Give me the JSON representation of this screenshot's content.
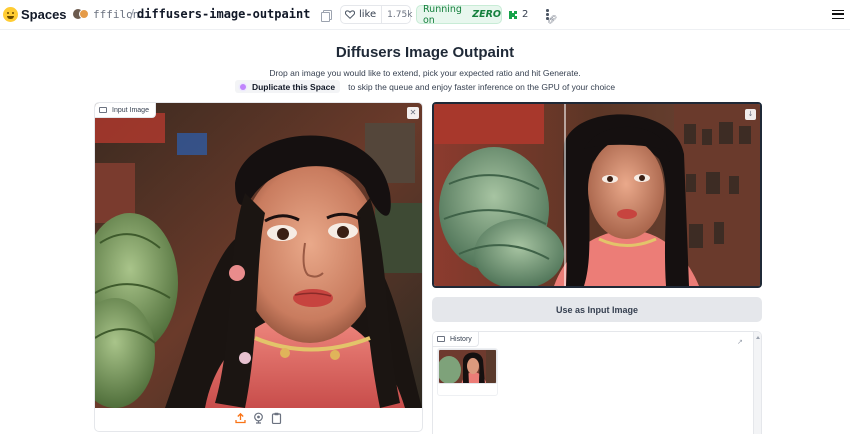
{
  "header": {
    "spaces_label": "Spaces",
    "owner": "fffiloni",
    "separator": "/",
    "repo_name": "diffusers-image-outpaint",
    "like_label": "like",
    "like_count": "1.75k",
    "status_prefix": "Running on",
    "status_hardware": "ZERO",
    "linked_count": "2"
  },
  "app": {
    "title": "Diffusers Image Outpaint",
    "subtitle": "Drop an image you would like to extend, pick your expected ratio and hit Generate.",
    "duplicate_label": "Duplicate this Space",
    "duplicate_note": "to skip the queue and enjoy faster inference on the GPU of your choice"
  },
  "input_image": {
    "label": "Input Image"
  },
  "use_as_input_button": "Use as Input Image",
  "history": {
    "label": "History"
  },
  "colors": {
    "running_green": "#15803d",
    "logo_yellow": "#ffcc33",
    "duplicate_dot": "#c084fc"
  },
  "icons": [
    "huggingface-logo",
    "copy-icon",
    "heart-icon",
    "puzzle-icon",
    "more-icon",
    "link-icon",
    "menu-icon",
    "image-icon",
    "close-icon",
    "upload-icon",
    "webcam-icon",
    "clipboard-icon",
    "download-icon",
    "share-icon"
  ]
}
